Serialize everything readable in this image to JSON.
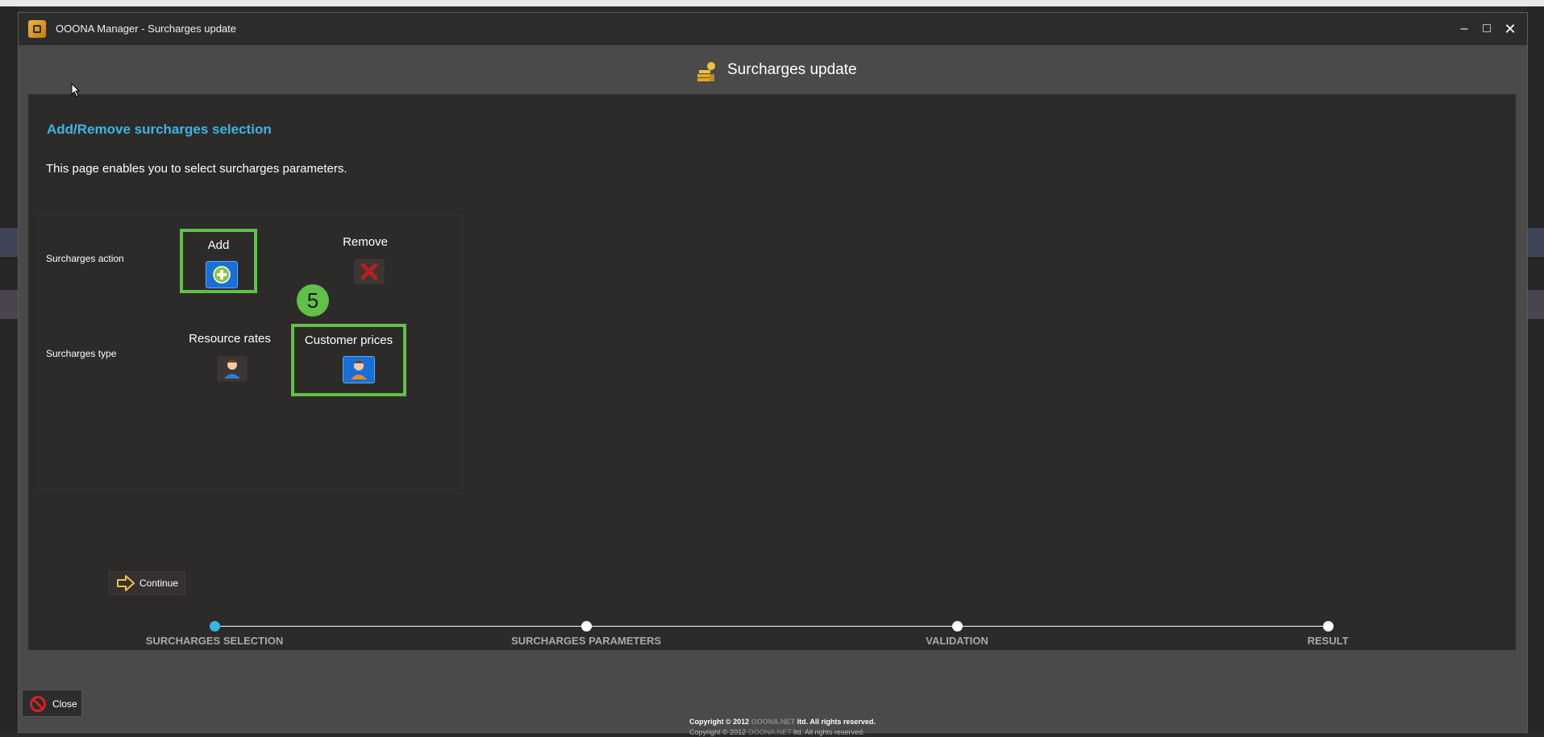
{
  "window": {
    "title": "OOONA Manager - Surcharges update",
    "controls": {
      "minimize": "–",
      "maximize": "□",
      "close": "✕"
    }
  },
  "header": {
    "title": "Surcharges update",
    "icon": "coins-icon"
  },
  "panel": {
    "title": "Add/Remove surcharges selection",
    "intro": "This page enables you to select surcharges parameters.",
    "action": {
      "label": "Surcharges action",
      "options": [
        {
          "label": "Add",
          "icon": "plus-icon",
          "selected": true
        },
        {
          "label": "Remove",
          "icon": "x-icon",
          "selected": false
        }
      ]
    },
    "type": {
      "label": "Surcharges type",
      "options": [
        {
          "label": "Resource rates",
          "icon": "person-icon",
          "selected": false
        },
        {
          "label": "Customer prices",
          "icon": "person-icon",
          "selected": true
        }
      ]
    },
    "step_badge": "5",
    "continue_label": "Continue"
  },
  "wizard": {
    "steps": [
      {
        "label": "SURCHARGES SELECTION",
        "current": true
      },
      {
        "label": "SURCHARGES PARAMETERS",
        "current": false
      },
      {
        "label": "VALIDATION",
        "current": false
      },
      {
        "label": "RESULT",
        "current": false
      }
    ]
  },
  "footer": {
    "close_label": "Close",
    "copyright_prefix": "Copyright © 2012 ",
    "brand": "OOONA.NET",
    "copyright_suffix": " ltd. All rights reserved."
  },
  "colors": {
    "accent_blue": "#38b7e7",
    "highlight_green": "#5fc147",
    "selected_button": "#1a6fd4",
    "panel_bg": "#2d2a2a",
    "window_bg": "#4a4a4a"
  }
}
